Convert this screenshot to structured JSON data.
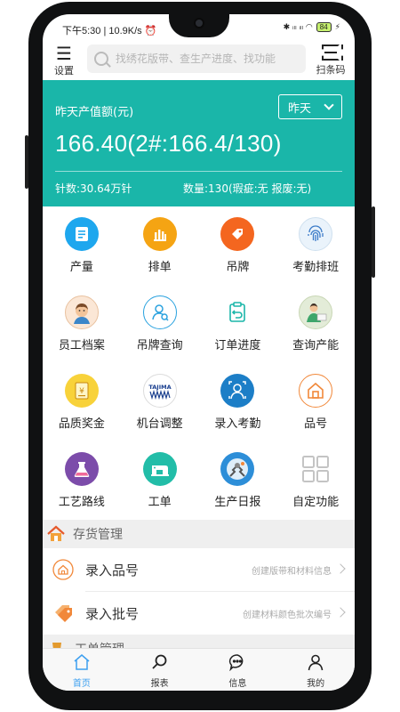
{
  "status": {
    "time": "下午5:30 | 10.9K/s ⏰",
    "network_icons": "✱ ᵢₗₗ ᵢₗₗ ◠",
    "battery": "84"
  },
  "topbar": {
    "settings_label": "设置",
    "search_placeholder": "找绣花版带、查生产进度、找功能",
    "scan_label": "扫条码"
  },
  "hero": {
    "label": "昨天产值额(元)",
    "period": "昨天",
    "value": "166.40(2#:166.4/130)",
    "stitches": "针数:30.64万针",
    "quantity": "数量:130(瑕疵:无 报废:无)",
    "color": "#1ab6a9"
  },
  "grid": {
    "items": [
      {
        "label": "产量",
        "icon": "output-icon"
      },
      {
        "label": "排单",
        "icon": "schedule-icon"
      },
      {
        "label": "吊牌",
        "icon": "tag-icon"
      },
      {
        "label": "考勤排班",
        "icon": "fingerprint-icon"
      },
      {
        "label": "员工档案",
        "icon": "employee-avatar-icon"
      },
      {
        "label": "吊牌查询",
        "icon": "tag-search-icon"
      },
      {
        "label": "订单进度",
        "icon": "order-progress-icon"
      },
      {
        "label": "查询产能",
        "icon": "capacity-icon"
      },
      {
        "label": "品质奖金",
        "icon": "bonus-icon"
      },
      {
        "label": "机台调整",
        "icon": "tajima-icon"
      },
      {
        "label": "录入考勤",
        "icon": "attendance-icon"
      },
      {
        "label": "品号",
        "icon": "product-icon"
      },
      {
        "label": "工艺路线",
        "icon": "process-icon"
      },
      {
        "label": "工单",
        "icon": "work-order-icon"
      },
      {
        "label": "生产日报",
        "icon": "daily-report-icon"
      },
      {
        "label": "自定功能",
        "icon": "custom-grid-icon"
      }
    ],
    "tajima_text": "TAJIMA"
  },
  "inventory": {
    "title": "存货管理",
    "rows": [
      {
        "title": "录入品号",
        "hint": "创建版带和材料信息"
      },
      {
        "title": "录入批号",
        "hint": "创建材料颜色批次编号"
      }
    ]
  },
  "workorder_section": {
    "title": "工单管理"
  },
  "nav": {
    "items": [
      {
        "label": "首页"
      },
      {
        "label": "报表"
      },
      {
        "label": "信息"
      },
      {
        "label": "我的"
      }
    ]
  },
  "colors": {
    "accent": "#1ab6a9",
    "nav_active": "#3c9ff0"
  }
}
